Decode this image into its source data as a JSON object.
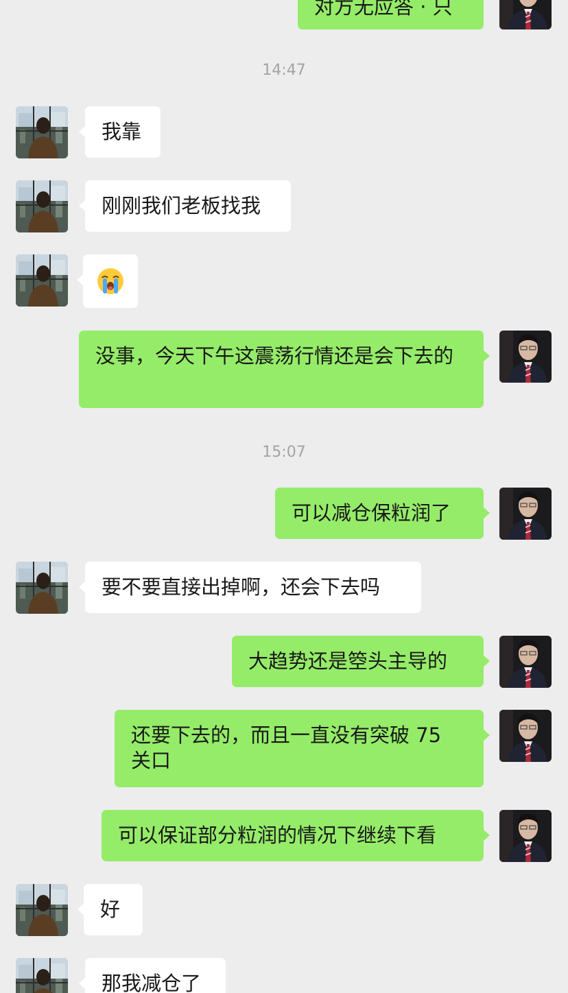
{
  "timestamps": [
    "14:47",
    "15:07"
  ],
  "messages": [
    {
      "side": "right",
      "text": "对方无应答 · 只"
    },
    {
      "side": "left",
      "text": "我靠"
    },
    {
      "side": "left",
      "text": "刚刚我们老板找我"
    },
    {
      "side": "left",
      "text": "",
      "emoji": "crying-face-emoji"
    },
    {
      "side": "right",
      "text": "没事，今天下午这震荡行情还是会下去的"
    },
    {
      "side": "right",
      "text": "可以减仓保粒润了"
    },
    {
      "side": "left",
      "text": "要不要直接出掉啊，还会下去吗"
    },
    {
      "side": "right",
      "text": "大趋势还是箜头主导的"
    },
    {
      "side": "right",
      "text": "还要下去的，而且一直没有突破 75 关口"
    },
    {
      "side": "right",
      "text": "可以保证部分粒润的情况下继续下看"
    },
    {
      "side": "left",
      "text": "好"
    },
    {
      "side": "left",
      "text": "那我减仓了"
    }
  ],
  "colors": {
    "background": "#ededed",
    "self_bubble": "#95ec69",
    "other_bubble": "#ffffff",
    "timestamp": "#a3a3a3"
  },
  "icons": {
    "other_avatar": "person-silhouette-window-avatar",
    "self_avatar": "man-in-suit-avatar"
  }
}
